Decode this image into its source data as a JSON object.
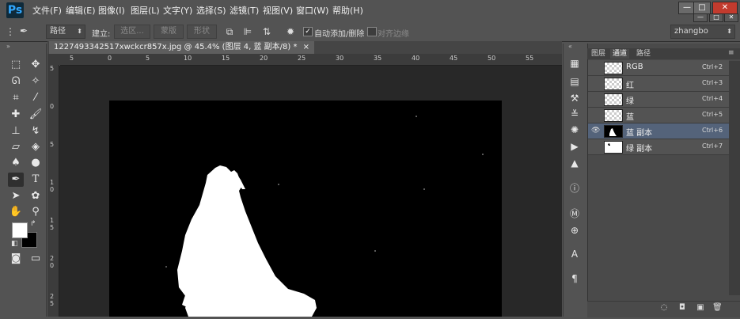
{
  "app": {
    "logo": "Ps",
    "menu": [
      "文件(F)",
      "编辑(E)",
      "图像(I)",
      "图层(L)",
      "文字(Y)",
      "选择(S)",
      "滤镜(T)",
      "视图(V)",
      "窗口(W)",
      "帮助(H)"
    ],
    "window_controls": [
      "—",
      "□",
      "✕",
      "—",
      "□",
      "✕"
    ]
  },
  "options": {
    "mode": "路径",
    "build_label": "建立:",
    "btn_selection": "选区...",
    "btn_mask": "蒙版",
    "btn_shape": "形状",
    "auto_add_label": "自动添加/删除",
    "auto_add_checked": true,
    "align_edges_label": "对齐边缘",
    "align_edges_checked": false,
    "workspace": "zhangbo"
  },
  "document": {
    "tab_title": "1227493342517xwckcr857x.jpg @ 45.4% (图层 4, 蓝 副本/8) *",
    "tab_close": "×",
    "ruler_top": [
      "5",
      "0",
      "5",
      "10",
      "15",
      "20",
      "25",
      "30",
      "35",
      "40",
      "45",
      "50",
      "55"
    ],
    "ruler_left": [
      "5",
      "0",
      "5",
      "1 0",
      "1 5",
      "2 0",
      "2 5"
    ]
  },
  "panel": {
    "tabs": [
      "图层",
      "通道",
      "路径"
    ],
    "active_tab": "通道",
    "channels": [
      {
        "name": "RGB",
        "shortcut": "Ctrl+2",
        "visible": false,
        "selected": false
      },
      {
        "name": "红",
        "shortcut": "Ctrl+3",
        "visible": false,
        "selected": false
      },
      {
        "name": "绿",
        "shortcut": "Ctrl+4",
        "visible": false,
        "selected": false
      },
      {
        "name": "蓝",
        "shortcut": "Ctrl+5",
        "visible": false,
        "selected": false
      },
      {
        "name": "蓝 副本",
        "shortcut": "Ctrl+6",
        "visible": true,
        "selected": true
      },
      {
        "name": "绿 副本",
        "shortcut": "Ctrl+7",
        "visible": false,
        "selected": false
      }
    ]
  },
  "colors": {
    "foreground": "#ffffff",
    "background": "#000000",
    "selection": "#54637a"
  }
}
